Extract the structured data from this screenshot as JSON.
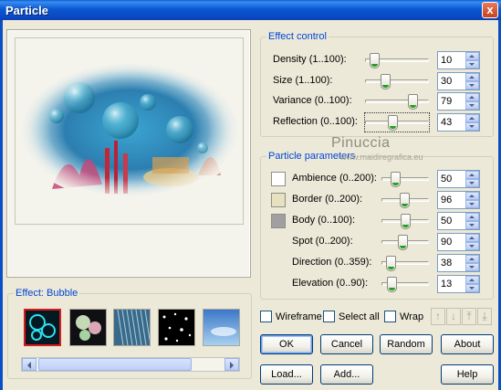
{
  "window": {
    "title": "Particle",
    "close_glyph": "x"
  },
  "effect_control": {
    "title": "Effect control",
    "rows": [
      {
        "label": "Density (1..100):",
        "value": "10",
        "fraction": 0.09
      },
      {
        "label": "Size (1..100):",
        "value": "30",
        "fraction": 0.29
      },
      {
        "label": "Variance (0..100):",
        "value": "79",
        "fraction": 0.79
      },
      {
        "label": "Reflection (0..100):",
        "value": "43",
        "fraction": 0.43
      }
    ]
  },
  "particle_parameters": {
    "title": "Particle parameters",
    "rows": [
      {
        "label": "Ambience (0..200):",
        "value": "50",
        "fraction": 0.25,
        "swatch": "#FFFFFF"
      },
      {
        "label": "Border (0..200):",
        "value": "96",
        "fraction": 0.48,
        "swatch": "#E6E1C0"
      },
      {
        "label": "Body (0..100):",
        "value": "50",
        "fraction": 0.5,
        "swatch": "#A0A0A0"
      },
      {
        "label": "Spot (0..200):",
        "value": "90",
        "fraction": 0.45
      },
      {
        "label": "Direction (0..359):",
        "value": "38",
        "fraction": 0.11
      },
      {
        "label": "Elevation (0..90):",
        "value": "13",
        "fraction": 0.14
      }
    ]
  },
  "watermark": {
    "line1": "Pinuccia",
    "line2": "www.maidiregrafica.eu"
  },
  "effect": {
    "label": "Effect: Bubble"
  },
  "checks": {
    "wireframe": "Wireframe",
    "select_all": "Select all",
    "wrap": "Wrap"
  },
  "buttons": {
    "ok": "OK",
    "cancel": "Cancel",
    "random": "Random",
    "about": "About",
    "load": "Load...",
    "add": "Add...",
    "help": "Help"
  },
  "icons": {
    "up": "↑",
    "down": "↓",
    "top": "⤒",
    "bottom": "⤓"
  }
}
